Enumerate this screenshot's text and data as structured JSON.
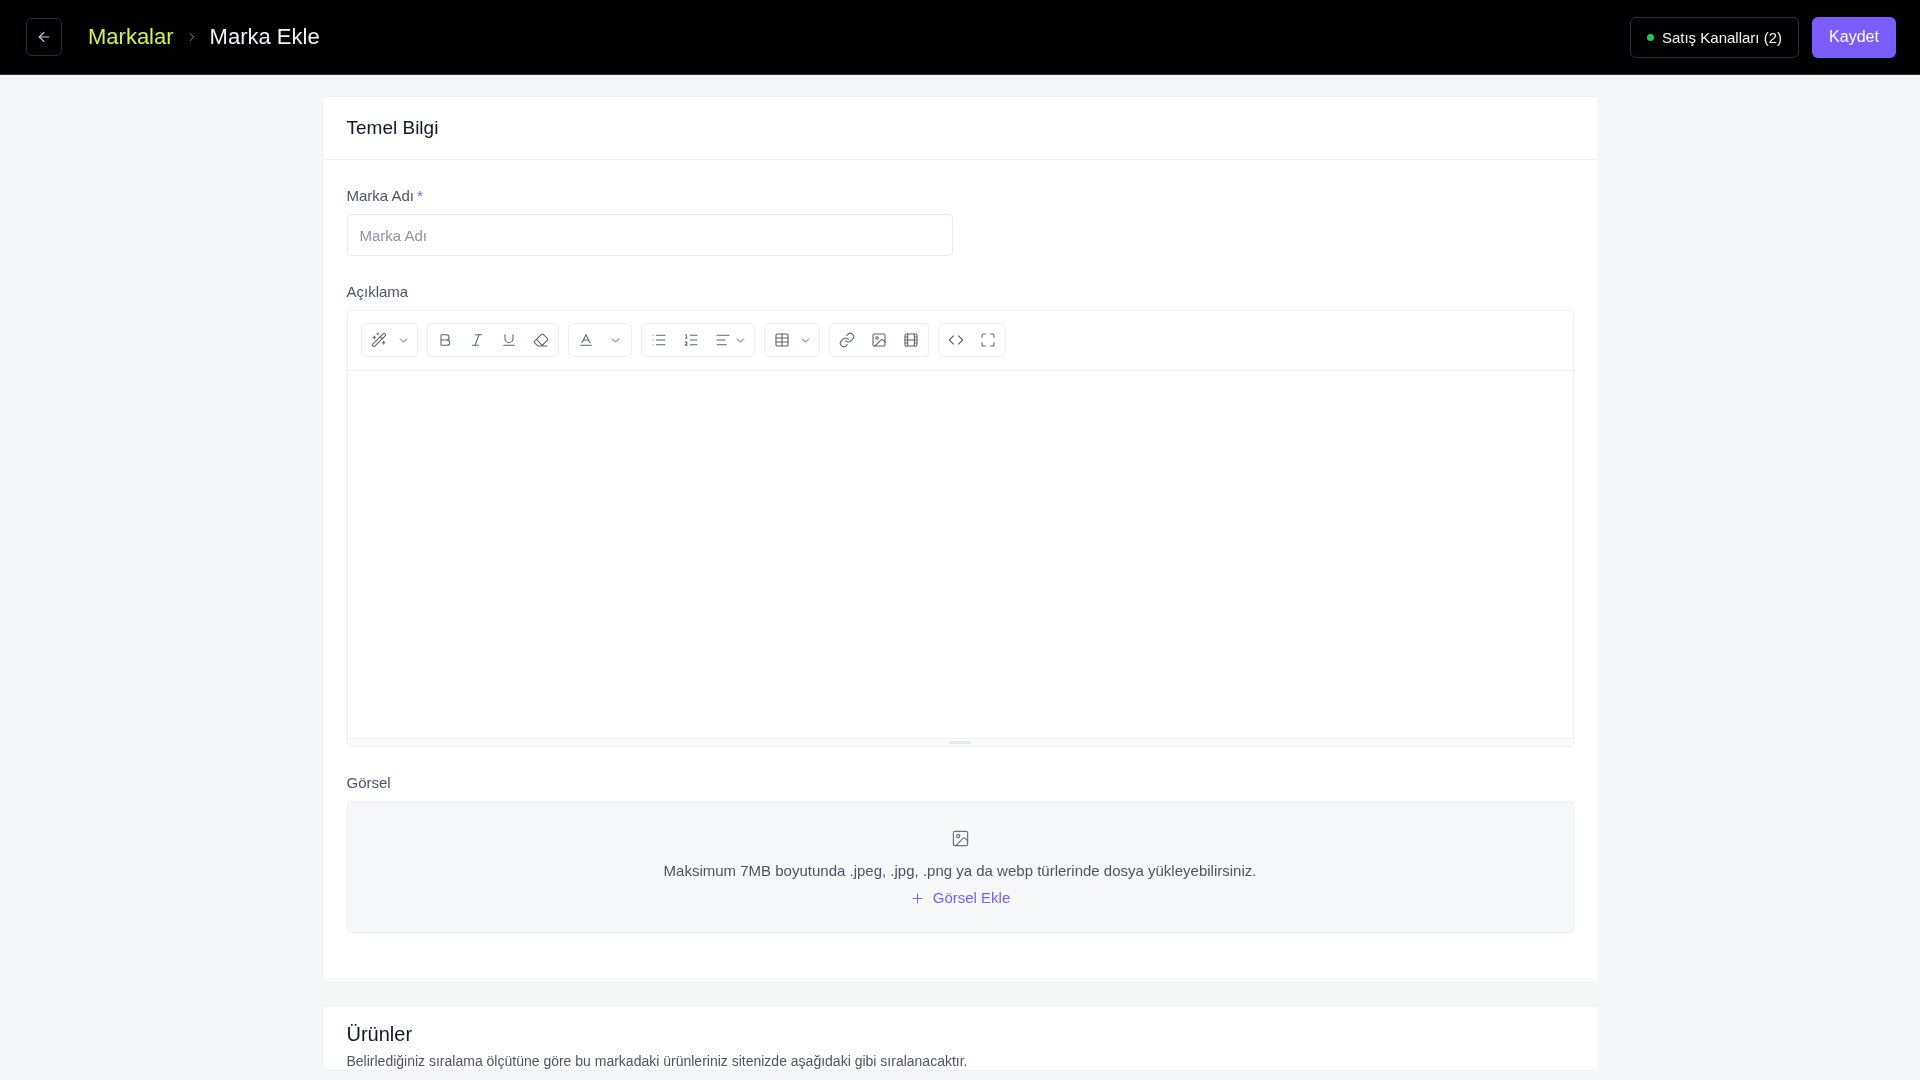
{
  "top_bar": {
    "breadcrumb": {
      "parent": "Markalar",
      "current": "Marka Ekle"
    },
    "channels_button": {
      "label": "Satış Kanalları (2)"
    },
    "save_button": {
      "label": "Kaydet"
    }
  },
  "basic_info": {
    "title": "Temel Bilgi",
    "fields": [
      {
        "kind": "text",
        "label": "Marka Adı",
        "required_mark": "*",
        "placeholder": "Marka Adı"
      },
      {
        "kind": "editor",
        "label": "Açıklama"
      },
      {
        "kind": "upload",
        "label": "Görsel",
        "hint": "Maksimum 7MB boyutunda .jpeg, .jpg, .png ya da webp türlerinde dosya yükleyebilirsiniz.",
        "add_label": "Görsel Ekle"
      }
    ]
  },
  "products": {
    "title": "Ürünler",
    "description": "Belirlediğiniz sıralama ölçütüne göre bu markadaki ürünleriniz sitenizde aşağıdaki gibi sıralanacaktır."
  }
}
